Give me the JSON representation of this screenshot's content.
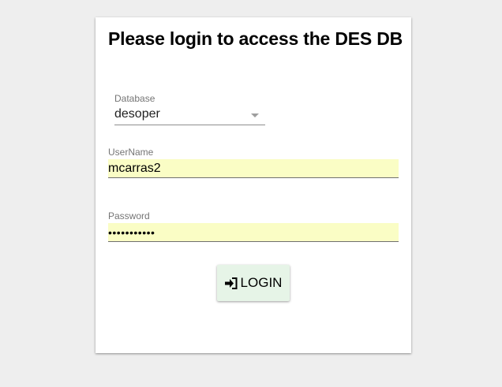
{
  "login_form": {
    "title": "Please login to access the DES DB",
    "database": {
      "label": "Database",
      "selected_value": "desoper"
    },
    "username": {
      "label": "UserName",
      "value": "mcarras2"
    },
    "password": {
      "label": "Password",
      "masked_value": "•••••••••••"
    },
    "login_button": {
      "label": "LOGIN",
      "icon": "sign-in-icon"
    }
  },
  "colors": {
    "page_background": "#eeeeee",
    "card_background": "#ffffff",
    "autofill_background": "#fafdc5",
    "button_background": "#e6f4e7",
    "label_text": "#757575"
  }
}
